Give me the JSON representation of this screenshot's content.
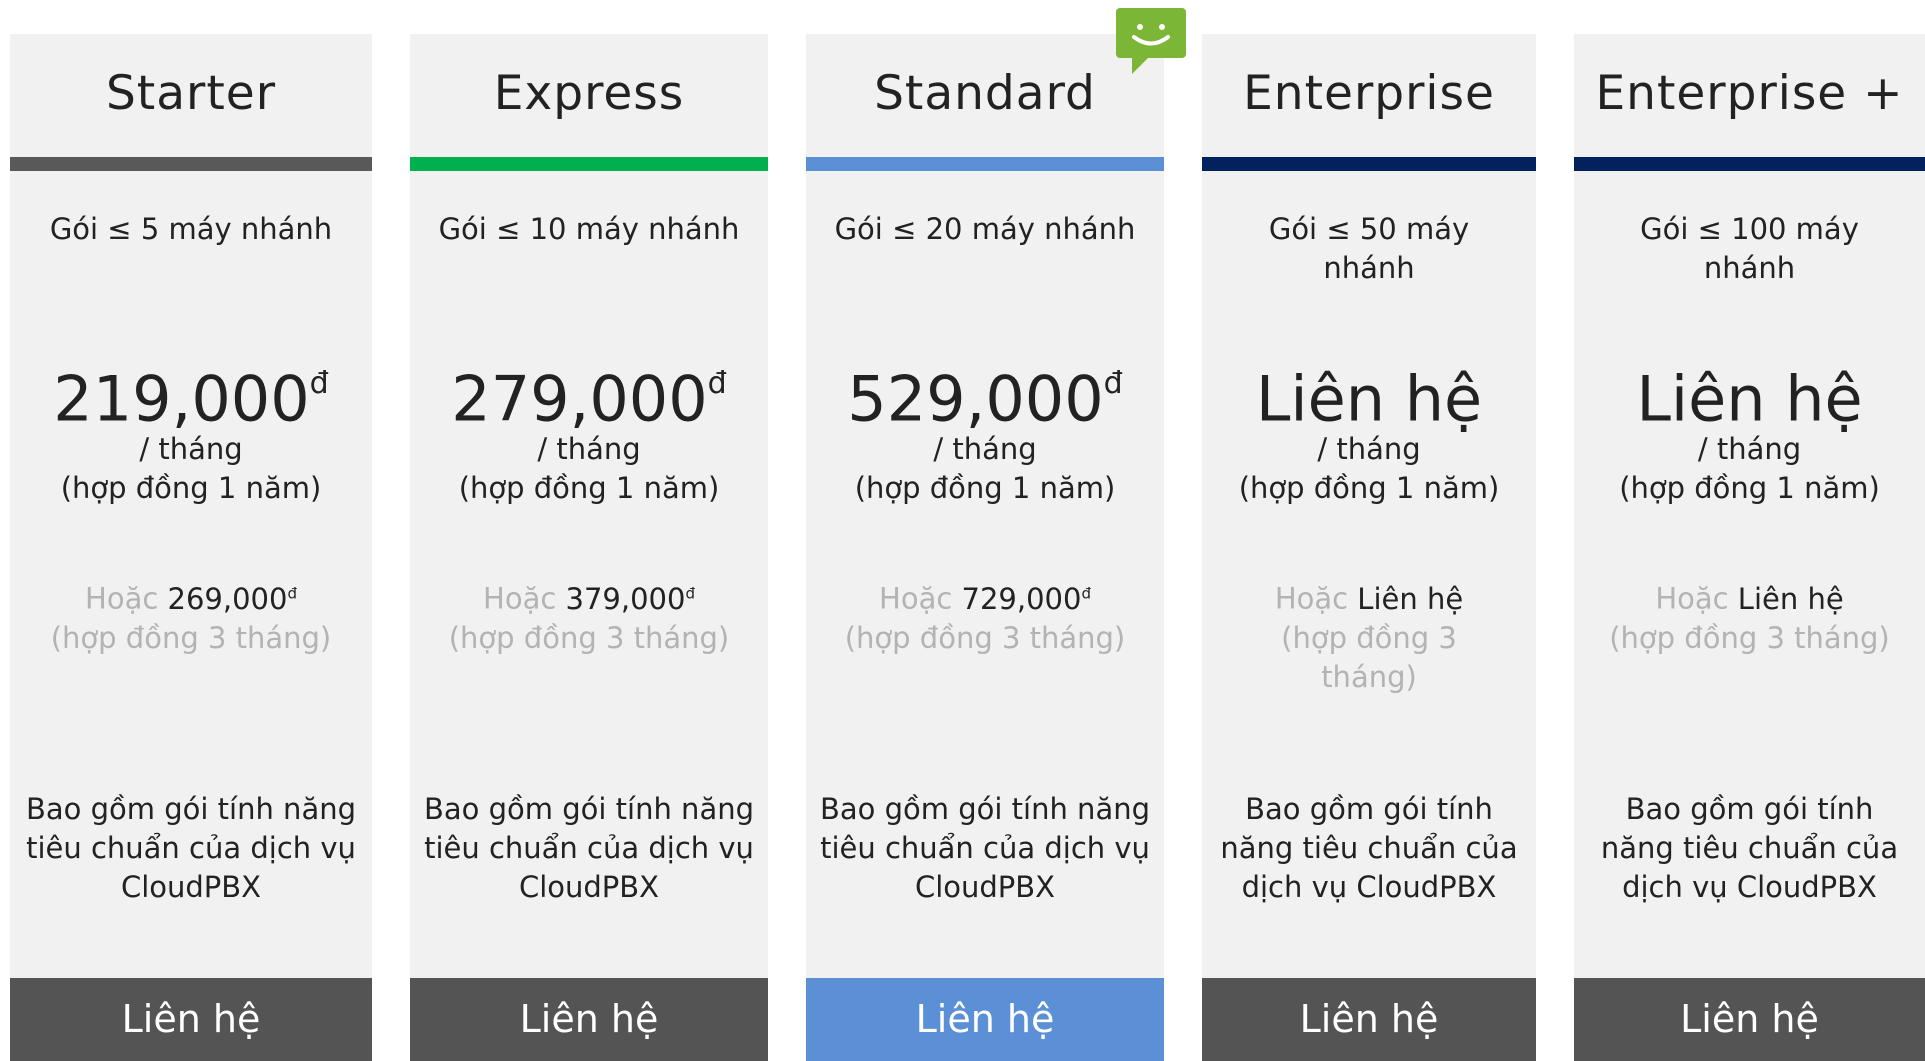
{
  "currency_symbol": "đ",
  "plans": [
    {
      "title": "Starter",
      "accent_color": "#595959",
      "extensions": "Gói ≤ 5 máy nhánh",
      "price": "219,000",
      "price_suffix": "đ",
      "period": "/ tháng",
      "term": "(hợp đồng 1 năm)",
      "alt_prefix": "Hoặc",
      "alt_price": "269,000",
      "alt_suffix": "đ",
      "alt_term": "(hợp đồng 3 tháng)",
      "description": "Bao gồm gói tính năng tiêu chuẩn của dịch vụ CloudPBX",
      "cta": "Liên hệ",
      "cta_color": "#545454"
    },
    {
      "title": "Express",
      "accent_color": "#00b04f",
      "extensions": "Gói ≤ 10 máy nhánh",
      "price": "279,000",
      "price_suffix": "đ",
      "period": "/ tháng",
      "term": "(hợp đồng 1 năm)",
      "alt_prefix": "Hoặc",
      "alt_price": "379,000",
      "alt_suffix": "đ",
      "alt_term": "(hợp đồng 3 tháng)",
      "description": "Bao gồm gói tính năng tiêu chuẩn của dịch vụ CloudPBX",
      "cta": "Liên hệ",
      "cta_color": "#545454"
    },
    {
      "title": "Standard",
      "accent_color": "#5b8fd6",
      "extensions": "Gói ≤ 20 máy nhánh",
      "price": "529,000",
      "price_suffix": "đ",
      "period": "/ tháng",
      "term": "(hợp đồng 1 năm)",
      "alt_prefix": "Hoặc",
      "alt_price": "729,000",
      "alt_suffix": "đ",
      "alt_term": "(hợp đồng 3 tháng)",
      "description": "Bao gồm gói tính năng tiêu chuẩn của dịch vụ CloudPBX",
      "cta": "Liên hệ",
      "cta_color": "#5b8fd6"
    },
    {
      "title": "Enterprise",
      "accent_color": "#03215c",
      "extensions": "Gói ≤ 50 máy nhánh",
      "price": "Liên hệ",
      "price_suffix": "",
      "period": "/ tháng",
      "term": "(hợp đồng 1 năm)",
      "alt_prefix": "Hoặc",
      "alt_price": "Liên hệ",
      "alt_suffix": "",
      "alt_term": "(hợp đồng 3 tháng)",
      "description": "Bao gồm gói tính năng tiêu chuẩn của dịch vụ CloudPBX",
      "cta": "Liên hệ",
      "cta_color": "#545454"
    },
    {
      "title": "Enterprise +",
      "accent_color": "#03215c",
      "extensions": "Gói ≤ 100 máy nhánh",
      "price": "Liên hệ",
      "price_suffix": "",
      "period": "/ tháng",
      "term": "(hợp đồng 1 năm)",
      "alt_prefix": "Hoặc",
      "alt_price": "Liên hệ",
      "alt_suffix": "",
      "alt_term": "(hợp đồng 3 tháng)",
      "description": "Bao gồm gói tính năng tiêu chuẩn của dịch vụ CloudPBX",
      "cta": "Liên hệ",
      "cta_color": "#545454"
    }
  ],
  "chat_icon": {
    "name": "chat-smiley-icon",
    "color": "#7cb636"
  }
}
